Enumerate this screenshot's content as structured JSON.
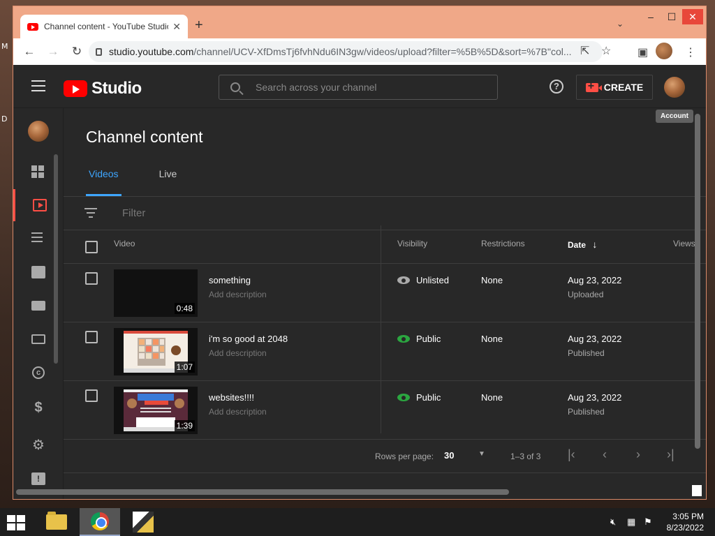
{
  "browser": {
    "tab_title": "Channel content - YouTube Studio",
    "url_domain": "studio.youtube.com",
    "url_path": "/channel/UCV-XfDmsTj6fvhNdu6IN3gw/videos/upload?filter=%5B%5D&sort=%7B\"col...",
    "new_tab_icon": "plus-icon",
    "window_controls": [
      "–",
      "☐",
      "✕"
    ]
  },
  "header": {
    "logo_text": "Studio",
    "search_placeholder": "Search across your channel",
    "create_label": "CREATE",
    "account_tooltip": "Account"
  },
  "page": {
    "title": "Channel content",
    "tabs": [
      {
        "label": "Videos",
        "selected": true
      },
      {
        "label": "Live",
        "selected": false
      }
    ],
    "filter_placeholder": "Filter"
  },
  "table": {
    "columns": {
      "video": "Video",
      "visibility": "Visibility",
      "restrictions": "Restrictions",
      "date": "Date",
      "date_sort": "↓",
      "views": "Views"
    },
    "rows": [
      {
        "title": "something",
        "description": "Add description",
        "duration": "0:48",
        "visibility": "Unlisted",
        "visibility_color": "#aaaaaa",
        "restrictions": "None",
        "date": "Aug 23, 2022",
        "date_status": "Uploaded"
      },
      {
        "title": "i'm so good at 2048",
        "description": "Add description",
        "duration": "1:07",
        "visibility": "Public",
        "visibility_color": "#2ba640",
        "restrictions": "None",
        "date": "Aug 23, 2022",
        "date_status": "Published"
      },
      {
        "title": "websites!!!!",
        "description": "Add description",
        "duration": "1:39",
        "visibility": "Public",
        "visibility_color": "#2ba640",
        "restrictions": "None",
        "date": "Aug 23, 2022",
        "date_status": "Published"
      }
    ]
  },
  "pagination": {
    "rows_per_page_label": "Rows per page:",
    "rows_per_page_value": "30",
    "range": "1–3 of 3"
  },
  "taskbar": {
    "time": "3:05 PM",
    "date": "8/23/2022"
  },
  "colors": {
    "accent_red": "#ff4e45",
    "tab_blue": "#3ea6ff",
    "bg_dark": "#282828",
    "public_green": "#2ba640"
  }
}
